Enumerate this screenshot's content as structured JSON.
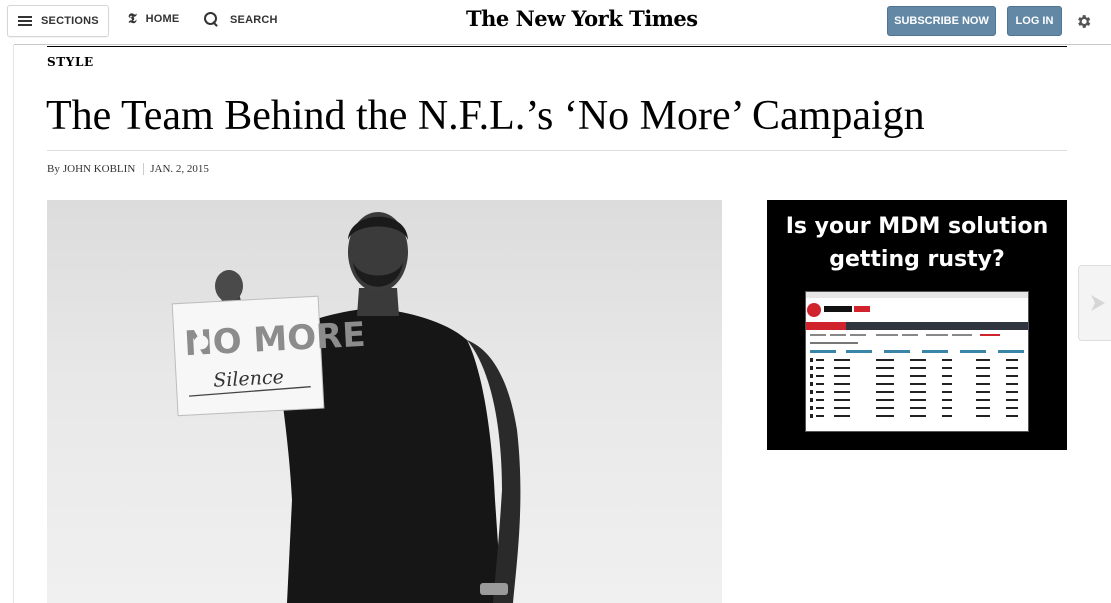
{
  "header": {
    "sections_label": "SECTIONS",
    "home_label": "HOME",
    "search_label": "SEARCH",
    "logo_text": "The New York Times",
    "subscribe_label": "SUBSCRIBE NOW",
    "login_label": "LOG IN"
  },
  "article": {
    "kicker": "STYLE",
    "headline": "The Team Behind the N.F.L.’s ‘No More’ Campaign",
    "byline_prefix": "By",
    "author": "JOHN KOBLIN",
    "date": "JAN. 2, 2015"
  },
  "photo": {
    "sign_title": "NO MORE",
    "sign_word": "Silence"
  },
  "ad": {
    "headline_line1": "Is your MDM solution",
    "headline_line2": "getting rusty?"
  },
  "colors": {
    "button_blue": "#6288a5",
    "ad_background": "#000000",
    "ad_accent_red": "#d0232b",
    "ad_accent_blue": "#3a86a8"
  },
  "icons": [
    "hamburger-icon",
    "nyt-t-icon",
    "search-icon",
    "gear-icon",
    "chevron-right-icon"
  ]
}
